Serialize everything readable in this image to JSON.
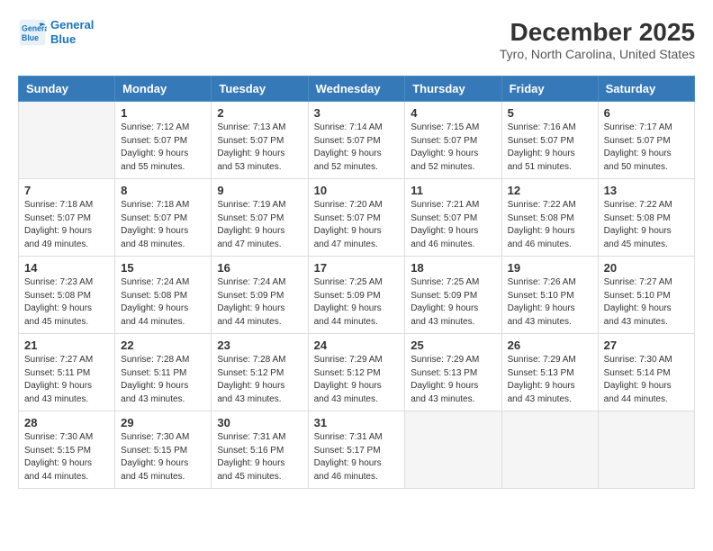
{
  "logo": {
    "line1": "General",
    "line2": "Blue"
  },
  "title": "December 2025",
  "subtitle": "Tyro, North Carolina, United States",
  "weekdays": [
    "Sunday",
    "Monday",
    "Tuesday",
    "Wednesday",
    "Thursday",
    "Friday",
    "Saturday"
  ],
  "weeks": [
    [
      {
        "day": "",
        "info": ""
      },
      {
        "day": "1",
        "info": "Sunrise: 7:12 AM\nSunset: 5:07 PM\nDaylight: 9 hours\nand 55 minutes."
      },
      {
        "day": "2",
        "info": "Sunrise: 7:13 AM\nSunset: 5:07 PM\nDaylight: 9 hours\nand 53 minutes."
      },
      {
        "day": "3",
        "info": "Sunrise: 7:14 AM\nSunset: 5:07 PM\nDaylight: 9 hours\nand 52 minutes."
      },
      {
        "day": "4",
        "info": "Sunrise: 7:15 AM\nSunset: 5:07 PM\nDaylight: 9 hours\nand 52 minutes."
      },
      {
        "day": "5",
        "info": "Sunrise: 7:16 AM\nSunset: 5:07 PM\nDaylight: 9 hours\nand 51 minutes."
      },
      {
        "day": "6",
        "info": "Sunrise: 7:17 AM\nSunset: 5:07 PM\nDaylight: 9 hours\nand 50 minutes."
      }
    ],
    [
      {
        "day": "7",
        "info": "Sunrise: 7:18 AM\nSunset: 5:07 PM\nDaylight: 9 hours\nand 49 minutes."
      },
      {
        "day": "8",
        "info": "Sunrise: 7:18 AM\nSunset: 5:07 PM\nDaylight: 9 hours\nand 48 minutes."
      },
      {
        "day": "9",
        "info": "Sunrise: 7:19 AM\nSunset: 5:07 PM\nDaylight: 9 hours\nand 47 minutes."
      },
      {
        "day": "10",
        "info": "Sunrise: 7:20 AM\nSunset: 5:07 PM\nDaylight: 9 hours\nand 47 minutes."
      },
      {
        "day": "11",
        "info": "Sunrise: 7:21 AM\nSunset: 5:07 PM\nDaylight: 9 hours\nand 46 minutes."
      },
      {
        "day": "12",
        "info": "Sunrise: 7:22 AM\nSunset: 5:08 PM\nDaylight: 9 hours\nand 46 minutes."
      },
      {
        "day": "13",
        "info": "Sunrise: 7:22 AM\nSunset: 5:08 PM\nDaylight: 9 hours\nand 45 minutes."
      }
    ],
    [
      {
        "day": "14",
        "info": "Sunrise: 7:23 AM\nSunset: 5:08 PM\nDaylight: 9 hours\nand 45 minutes."
      },
      {
        "day": "15",
        "info": "Sunrise: 7:24 AM\nSunset: 5:08 PM\nDaylight: 9 hours\nand 44 minutes."
      },
      {
        "day": "16",
        "info": "Sunrise: 7:24 AM\nSunset: 5:09 PM\nDaylight: 9 hours\nand 44 minutes."
      },
      {
        "day": "17",
        "info": "Sunrise: 7:25 AM\nSunset: 5:09 PM\nDaylight: 9 hours\nand 44 minutes."
      },
      {
        "day": "18",
        "info": "Sunrise: 7:25 AM\nSunset: 5:09 PM\nDaylight: 9 hours\nand 43 minutes."
      },
      {
        "day": "19",
        "info": "Sunrise: 7:26 AM\nSunset: 5:10 PM\nDaylight: 9 hours\nand 43 minutes."
      },
      {
        "day": "20",
        "info": "Sunrise: 7:27 AM\nSunset: 5:10 PM\nDaylight: 9 hours\nand 43 minutes."
      }
    ],
    [
      {
        "day": "21",
        "info": "Sunrise: 7:27 AM\nSunset: 5:11 PM\nDaylight: 9 hours\nand 43 minutes."
      },
      {
        "day": "22",
        "info": "Sunrise: 7:28 AM\nSunset: 5:11 PM\nDaylight: 9 hours\nand 43 minutes."
      },
      {
        "day": "23",
        "info": "Sunrise: 7:28 AM\nSunset: 5:12 PM\nDaylight: 9 hours\nand 43 minutes."
      },
      {
        "day": "24",
        "info": "Sunrise: 7:29 AM\nSunset: 5:12 PM\nDaylight: 9 hours\nand 43 minutes."
      },
      {
        "day": "25",
        "info": "Sunrise: 7:29 AM\nSunset: 5:13 PM\nDaylight: 9 hours\nand 43 minutes."
      },
      {
        "day": "26",
        "info": "Sunrise: 7:29 AM\nSunset: 5:13 PM\nDaylight: 9 hours\nand 43 minutes."
      },
      {
        "day": "27",
        "info": "Sunrise: 7:30 AM\nSunset: 5:14 PM\nDaylight: 9 hours\nand 44 minutes."
      }
    ],
    [
      {
        "day": "28",
        "info": "Sunrise: 7:30 AM\nSunset: 5:15 PM\nDaylight: 9 hours\nand 44 minutes."
      },
      {
        "day": "29",
        "info": "Sunrise: 7:30 AM\nSunset: 5:15 PM\nDaylight: 9 hours\nand 45 minutes."
      },
      {
        "day": "30",
        "info": "Sunrise: 7:31 AM\nSunset: 5:16 PM\nDaylight: 9 hours\nand 45 minutes."
      },
      {
        "day": "31",
        "info": "Sunrise: 7:31 AM\nSunset: 5:17 PM\nDaylight: 9 hours\nand 46 minutes."
      },
      {
        "day": "",
        "info": ""
      },
      {
        "day": "",
        "info": ""
      },
      {
        "day": "",
        "info": ""
      }
    ]
  ]
}
